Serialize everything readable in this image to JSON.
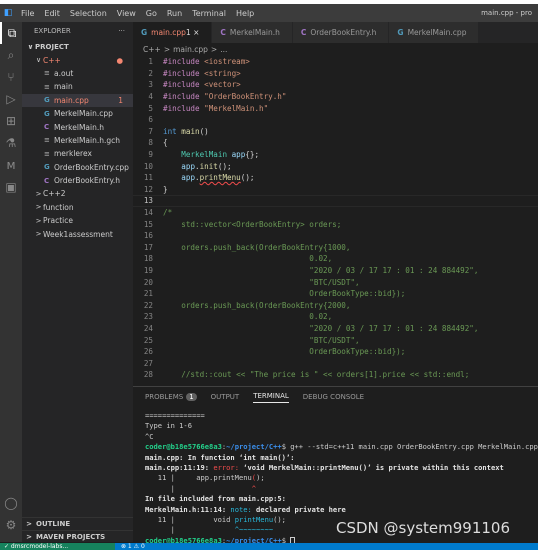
{
  "window": {
    "title": "main.cpp - pro"
  },
  "menu": [
    "File",
    "Edit",
    "Selection",
    "View",
    "Go",
    "Run",
    "Terminal",
    "Help"
  ],
  "activity": [
    {
      "icon": "files-icon",
      "g": "⧉"
    },
    {
      "icon": "search-icon",
      "g": "⌕"
    },
    {
      "icon": "source-control-icon",
      "g": "⑂"
    },
    {
      "icon": "run-debug-icon",
      "g": "▷"
    },
    {
      "icon": "extensions-icon",
      "g": "⊞"
    },
    {
      "icon": "testing-icon",
      "g": "⚗"
    },
    {
      "icon": "maven-icon",
      "g": "м"
    },
    {
      "icon": "remote-explorer-icon",
      "g": "▣"
    }
  ],
  "activity_bottom": [
    {
      "icon": "account-icon",
      "g": "◯"
    },
    {
      "icon": "settings-gear-icon",
      "g": "⚙"
    }
  ],
  "sidebar": {
    "title": "EXPLORER",
    "more": "···",
    "root": "PROJECT",
    "items": [
      {
        "label": "C++",
        "depth": 1,
        "chev": "∨",
        "color": "red",
        "badge": "●"
      },
      {
        "label": "a.out",
        "depth": 2,
        "icon": "≡",
        "ic": "gray"
      },
      {
        "label": "main",
        "depth": 2,
        "icon": "≡",
        "ic": "gray"
      },
      {
        "label": "main.cpp",
        "depth": 2,
        "icon": "G",
        "ic": "blue",
        "color": "red",
        "badge": "1",
        "sel": true
      },
      {
        "label": "MerkelMain.cpp",
        "depth": 2,
        "icon": "G",
        "ic": "blue"
      },
      {
        "label": "MerkelMain.h",
        "depth": 2,
        "icon": "C",
        "ic": "purple"
      },
      {
        "label": "MerkelMain.h.gch",
        "depth": 2,
        "icon": "≡",
        "ic": "gray"
      },
      {
        "label": "merklerex",
        "depth": 2,
        "icon": "≡",
        "ic": "gray"
      },
      {
        "label": "OrderBookEntry.cpp",
        "depth": 2,
        "icon": "G",
        "ic": "blue"
      },
      {
        "label": "OrderBookEntry.h",
        "depth": 2,
        "icon": "C",
        "ic": "purple"
      },
      {
        "label": "C++2",
        "depth": 1,
        "chev": ">"
      },
      {
        "label": "function",
        "depth": 1,
        "chev": ">"
      },
      {
        "label": "Practice",
        "depth": 1,
        "chev": ">"
      },
      {
        "label": "Week1assessment",
        "depth": 1,
        "chev": ">"
      }
    ],
    "outline": "OUTLINE",
    "maven": "MAVEN PROJECTS"
  },
  "tabs": [
    {
      "label": "main.cpp",
      "icon": "G",
      "ic": "blue",
      "extra": "1 ×",
      "active": true
    },
    {
      "label": "MerkelMain.h",
      "icon": "C",
      "ic": "purple"
    },
    {
      "label": "OrderBookEntry.h",
      "icon": "C",
      "ic": "purple"
    },
    {
      "label": "MerkelMain.cpp",
      "icon": "G",
      "ic": "blue"
    }
  ],
  "breadcrumb": [
    "C++",
    ">",
    "main.cpp",
    ">",
    "..."
  ],
  "code": [
    [
      [
        "#include ",
        "pp"
      ],
      [
        "<iostream>",
        "str"
      ]
    ],
    [
      [
        "#include ",
        "pp"
      ],
      [
        "<string>",
        "str"
      ]
    ],
    [
      [
        "#include ",
        "pp"
      ],
      [
        "<vector>",
        "str"
      ]
    ],
    [
      [
        "#include ",
        "pp"
      ],
      [
        "\"OrderBookEntry.h\"",
        "str"
      ]
    ],
    [
      [
        "#include ",
        "pp"
      ],
      [
        "\"MerkelMain.h\"",
        "str"
      ]
    ],
    [],
    [
      [
        "int ",
        "kw"
      ],
      [
        "main",
        "fn"
      ],
      [
        "()",
        "pl"
      ]
    ],
    [
      [
        "{",
        "pl"
      ]
    ],
    [
      [
        "    ",
        "pl"
      ],
      [
        "MerkelMain ",
        "ty"
      ],
      [
        "app",
        "va"
      ],
      [
        "{};",
        "pl"
      ]
    ],
    [
      [
        "    ",
        "pl"
      ],
      [
        "app",
        "va"
      ],
      [
        ".",
        "pl"
      ],
      [
        "init",
        "fn"
      ],
      [
        "();",
        "pl"
      ]
    ],
    [
      [
        "    ",
        "pl"
      ],
      [
        "app",
        "va"
      ],
      [
        ".",
        "pl"
      ],
      [
        "printMenu",
        "fn squig"
      ],
      [
        "();",
        "pl"
      ]
    ],
    [
      [
        "}",
        "pl"
      ]
    ],
    [],
    [
      [
        "/*",
        "cm"
      ]
    ],
    [
      [
        "    std::vector<OrderBookEntry> orders;",
        "cm"
      ]
    ],
    [],
    [
      [
        "    orders.push_back(OrderBookEntry{1000,",
        "cm"
      ]
    ],
    [
      [
        "                                0.02,",
        "cm"
      ]
    ],
    [
      [
        "                                \"2020 / 03 / 17 17 : 01 : 24 884492\",",
        "cm"
      ]
    ],
    [
      [
        "                                \"BTC/USDT\",",
        "cm"
      ]
    ],
    [
      [
        "                                OrderBookType::bid});",
        "cm"
      ]
    ],
    [
      [
        "    orders.push_back(OrderBookEntry{2000,",
        "cm"
      ]
    ],
    [
      [
        "                                0.02,",
        "cm"
      ]
    ],
    [
      [
        "                                \"2020 / 03 / 17 17 : 01 : 24 884492\",",
        "cm"
      ]
    ],
    [
      [
        "                                \"BTC/USDT\",",
        "cm"
      ]
    ],
    [
      [
        "                                OrderBookType::bid});",
        "cm"
      ]
    ],
    [],
    [
      [
        "    //std::cout << \"The price is \" << orders[1].price << std::endl;",
        "cm"
      ]
    ]
  ],
  "current_line": 13,
  "panel": {
    "tabs": [
      {
        "label": "PROBLEMS",
        "badge": "1"
      },
      {
        "label": "OUTPUT"
      },
      {
        "label": "TERMINAL",
        "active": true
      },
      {
        "label": "DEBUG CONSOLE"
      }
    ]
  },
  "terminal": [
    [
      [
        "==============",
        ""
      ]
    ],
    [
      [
        "Type in 1-6",
        ""
      ]
    ],
    [
      [
        "^C",
        ""
      ]
    ],
    [
      [
        "coder@b18e5766e8a3",
        "g"
      ],
      [
        ":",
        ""
      ],
      [
        "~/project/C++",
        "b"
      ],
      [
        "$ g++ --std=c++11 main.cpp OrderBookEntry.cpp MerkelMain.cpp",
        ""
      ]
    ],
    [
      [
        "main.cpp:",
        "w"
      ],
      [
        " In function ‘",
        "w"
      ],
      [
        "int main()",
        "w"
      ],
      [
        "’:",
        "w"
      ]
    ],
    [
      [
        "main.cpp:11:19: ",
        "w"
      ],
      [
        "error: ",
        "e"
      ],
      [
        "‘void MerkelMain::printMenu()’ is private within this context",
        "w"
      ]
    ],
    [
      [
        "   11 |     app.printMenu",
        ""
      ],
      [
        "(",
        "e"
      ],
      [
        ");",
        ""
      ]
    ],
    [
      [
        "      |                  ",
        ""
      ],
      [
        "^",
        "e"
      ]
    ],
    [
      [
        "In file included from main.cpp:5:",
        "w"
      ]
    ],
    [
      [
        "MerkelMain.h:11:14: ",
        "w"
      ],
      [
        "note: ",
        "n"
      ],
      [
        "declared private here",
        "w"
      ]
    ],
    [
      [
        "   11 |         void ",
        ""
      ],
      [
        "printMenu",
        "n"
      ],
      [
        "();",
        ""
      ]
    ],
    [
      [
        "      |              ",
        ""
      ],
      [
        "^~~~~~~~~",
        "n"
      ]
    ],
    [
      [
        "coder@b18e5766e8a3",
        "g"
      ],
      [
        ":",
        ""
      ],
      [
        "~/project/C++",
        "b"
      ],
      [
        "$ ",
        ""
      ]
    ]
  ],
  "watermark": "CSDN @system991106",
  "status": {
    "remote": "✓ dmsrcmodel-labs...",
    "problems": "⊗ 1 ⚠ 0"
  }
}
